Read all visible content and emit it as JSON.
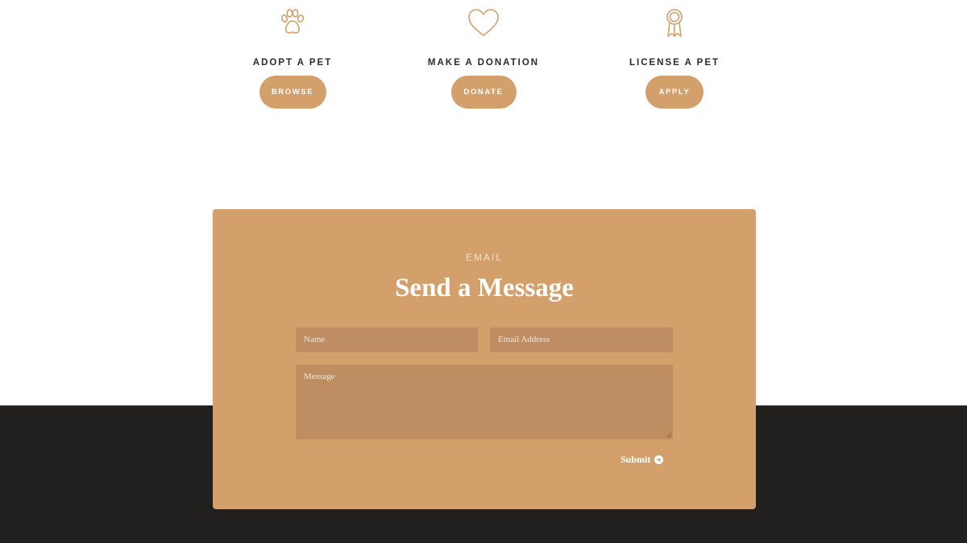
{
  "actions": [
    {
      "icon": "paw-icon",
      "title": "ADOPT A PET",
      "button": "BROWSE"
    },
    {
      "icon": "heart-icon",
      "title": "MAKE A DONATION",
      "button": "DONATE"
    },
    {
      "icon": "award-ribbon-icon",
      "title": "LICENSE A PET",
      "button": "APPLY"
    }
  ],
  "contact": {
    "eyebrow": "EMAIL",
    "title": "Send a Message",
    "name_placeholder": "Name",
    "email_placeholder": "Email Address",
    "message_placeholder": "Message",
    "submit_label": "Submit",
    "submit_icon": "arrow-right-circle-icon"
  },
  "colors": {
    "accent": "#d3a06c",
    "field": "#be8d62",
    "dark_band": "#222120",
    "heading_text": "#2b2b2b"
  }
}
